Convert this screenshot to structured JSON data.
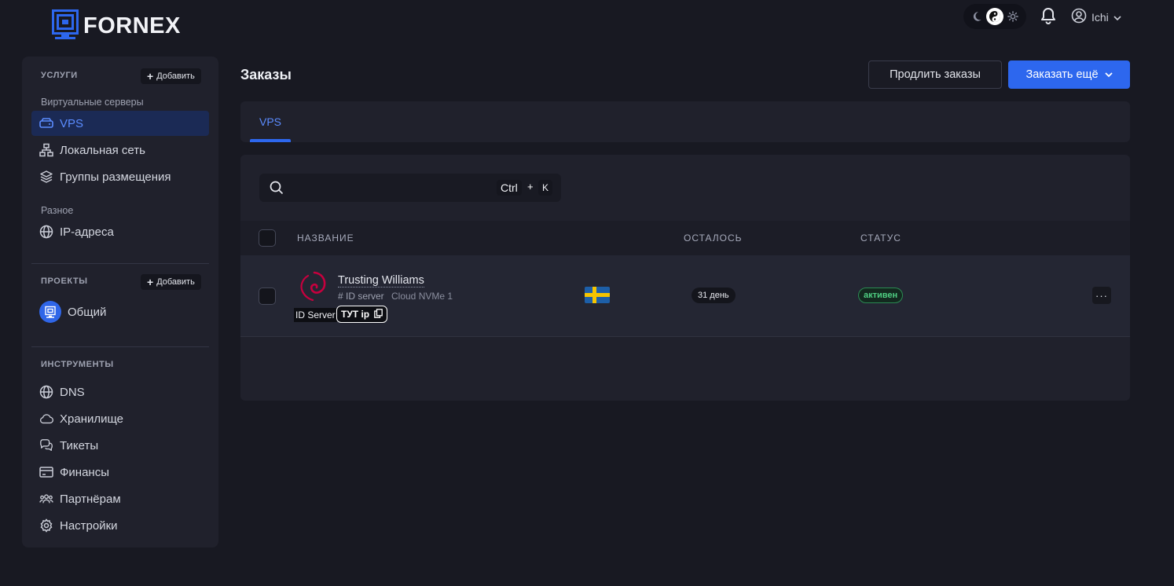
{
  "brand": {
    "name": "FORNEX",
    "accent": "#2d67ee"
  },
  "topbar": {
    "theme_options": [
      "moon-icon",
      "auto-theme-icon",
      "sun-icon"
    ],
    "user_name": "Ichi"
  },
  "sidebar": {
    "services": {
      "heading": "УСЛУГИ",
      "add_label": "Добавить",
      "group_virtual": "Виртуальные серверы",
      "items": [
        {
          "label": "VPS",
          "icon": "server-icon",
          "active": true
        },
        {
          "label": "Локальная сеть",
          "icon": "network-icon"
        },
        {
          "label": "Группы размещения",
          "icon": "layers-icon"
        }
      ],
      "group_misc": "Разное",
      "misc_items": [
        {
          "label": "IP-адреса",
          "icon": "globe-icon"
        }
      ]
    },
    "projects": {
      "heading": "ПРОЕКТЫ",
      "add_label": "Добавить",
      "items": [
        {
          "label": "Общий",
          "icon": "project-icon"
        }
      ]
    },
    "tools": {
      "heading": "ИНСТРУМЕНТЫ",
      "items": [
        {
          "label": "DNS",
          "icon": "globe-icon"
        },
        {
          "label": "Хранилище",
          "icon": "cloud-icon"
        },
        {
          "label": "Тикеты",
          "icon": "chat-icon"
        },
        {
          "label": "Финансы",
          "icon": "card-icon"
        },
        {
          "label": "Партнёрам",
          "icon": "users-icon"
        },
        {
          "label": "Настройки",
          "icon": "gear-icon"
        }
      ]
    }
  },
  "main": {
    "title": "Заказы",
    "renew_label": "Продлить заказы",
    "order_more_label": "Заказать ещё",
    "tabs": [
      {
        "label": "VPS",
        "active": true
      }
    ],
    "search": {
      "placeholder": "",
      "shortcut_ctrl": "Ctrl",
      "shortcut_plus": "+",
      "shortcut_key": "K"
    },
    "table": {
      "columns": [
        "НАЗВАНИЕ",
        "ОСТАЛОСЬ",
        "СТАТУС"
      ],
      "rows": [
        {
          "name": "Trusting Williams",
          "id_text": "# ID server",
          "plan": "Cloud NVMe 1",
          "os_icon": "debian-icon",
          "tag_id": "ID Server",
          "tag_ip": "ТУТ ip",
          "location_flag": "sweden-flag-icon",
          "remaining": "31 день",
          "status": "активен",
          "status_color": "#4fd083",
          "more_label": "···"
        }
      ]
    }
  }
}
